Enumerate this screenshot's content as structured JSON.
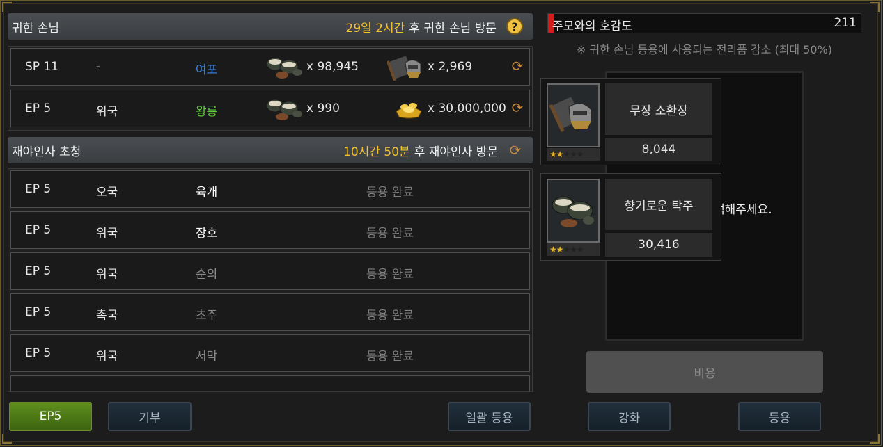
{
  "vip_guest": {
    "title": "귀한 손님",
    "timer": "29일 2시간",
    "suffix": "후 귀한 손님 방문",
    "rows": [
      {
        "ep": "SP 11",
        "nation": "-",
        "name": "여포",
        "item1_qty": "x 98,945",
        "item2_qty": "x 2,969"
      },
      {
        "ep": "EP 5",
        "nation": "위국",
        "name": "왕릉",
        "item1_qty": "x 990",
        "item2_qty": "x 30,000,000"
      }
    ]
  },
  "recruit": {
    "title": "재야인사 초청",
    "timer": "10시간 50분",
    "suffix": "후 재야인사 방문",
    "rows": [
      {
        "ep": "EP 5",
        "nation": "오국",
        "name": "육개",
        "status": "등용 완료"
      },
      {
        "ep": "EP 5",
        "nation": "위국",
        "name": "장호",
        "status": "등용 완료"
      },
      {
        "ep": "EP 5",
        "nation": "위국",
        "name": "순의",
        "status": "등용 완료"
      },
      {
        "ep": "EP 5",
        "nation": "촉국",
        "name": "초주",
        "status": "등용 완료"
      },
      {
        "ep": "EP 5",
        "nation": "위국",
        "name": "서막",
        "status": "등용 완료"
      }
    ]
  },
  "buttons": {
    "ep5": "EP5",
    "donate": "기부",
    "bulk_recruit": "일괄 등용",
    "cost": "비용",
    "enhance": "강화",
    "recruit": "등용"
  },
  "affinity": {
    "label": "주모와의 호감도",
    "value": "211",
    "fill_fraction": 0.02,
    "note": "※ 귀한 손님 등용에 사용되는 전리품 감소 (최대 50%)"
  },
  "items": [
    {
      "name": "무장 소환장",
      "count": "8,044",
      "stars": 2,
      "icon": "scroll-helmet-icon"
    },
    {
      "name": "향기로운 탁주",
      "count": "30,416",
      "stars": 2,
      "icon": "wine-bowls-icon"
    }
  ],
  "select_hint": "택해주세요.",
  "colors": {
    "accent_yellow": "#f2c230",
    "name_blue": "#3f87e8",
    "name_green": "#5fce3a",
    "affinity_bar": "#d21d1d"
  }
}
